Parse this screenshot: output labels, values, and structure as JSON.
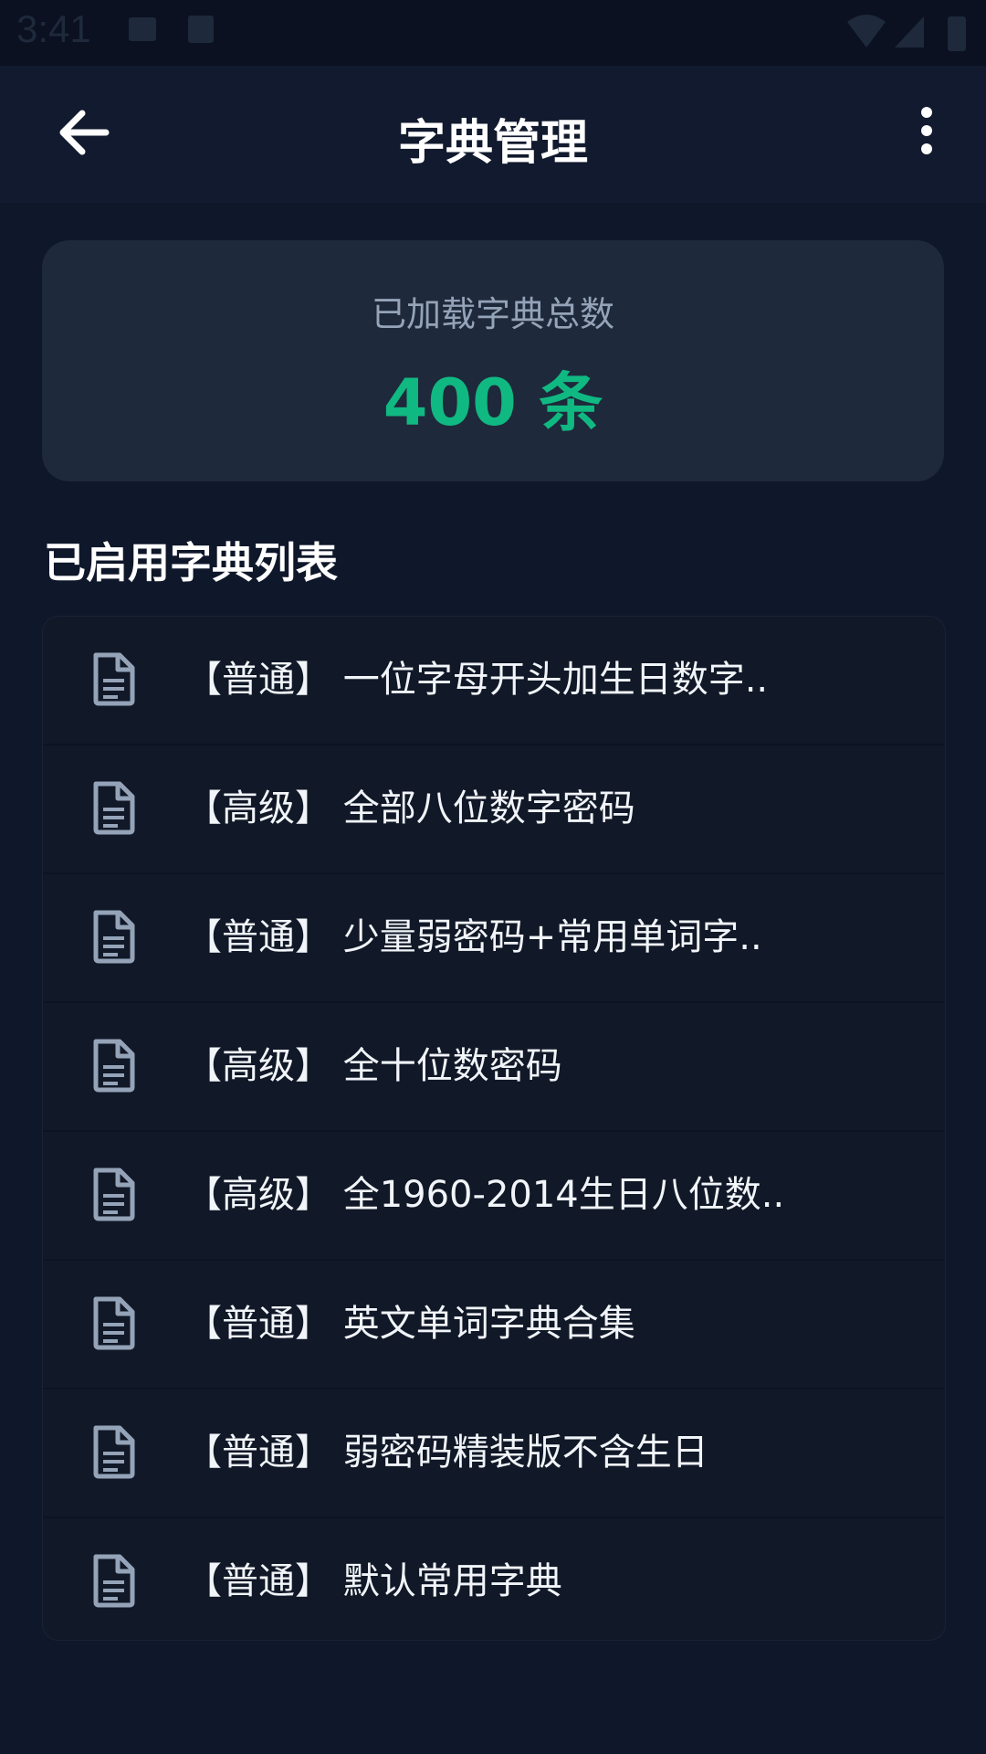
{
  "status_bar": {
    "time": "3:41"
  },
  "app_bar": {
    "title": "字典管理",
    "back_icon": "arrow-left-icon",
    "more_icon": "more-vert-icon"
  },
  "summary": {
    "label": "已加载字典总数",
    "value": "400 条"
  },
  "section": {
    "title": "已启用字典列表"
  },
  "dictionaries": [
    {
      "text": "【普通】 一位字母开头加生日数字.."
    },
    {
      "text": "【高级】 全部八位数字密码"
    },
    {
      "text": "【普通】 少量弱密码+常用单词字.."
    },
    {
      "text": "【高级】 全十位数密码"
    },
    {
      "text": "【高级】 全1960-2014生日八位数.."
    },
    {
      "text": "【普通】 英文单词字典合集"
    },
    {
      "text": "【普通】 弱密码精装版不含生日"
    },
    {
      "text": "【普通】 默认常用字典"
    }
  ],
  "colors": {
    "background": "#0f172a",
    "card": "#1e293b",
    "accent": "#10b981",
    "muted": "#94a3b8"
  }
}
